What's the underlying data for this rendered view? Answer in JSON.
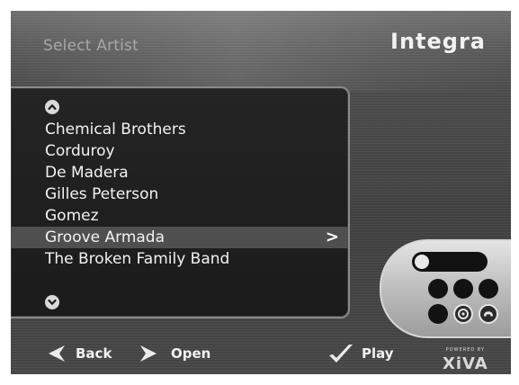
{
  "header": {
    "title": "Select Artist",
    "brand": "Integra"
  },
  "artist_list": {
    "items": [
      "Chemical Brothers",
      "Corduroy",
      "De Madera",
      "Gilles Peterson",
      "Gomez",
      "Groove Armada",
      "The Broken Family Band"
    ],
    "selected_index": 5,
    "selected_indicator": ">"
  },
  "footer": {
    "back_label": "Back",
    "open_label": "Open",
    "play_label": "Play",
    "powered_by": "POWERED BY",
    "logo": "XiVA"
  },
  "icons": {
    "scroll_up": "chevron-up-icon",
    "scroll_down": "chevron-down-icon",
    "back": "arrow-left-icon",
    "open": "arrow-right-icon",
    "play": "checkmark-icon"
  },
  "colors": {
    "background": "#4a4a4a",
    "list_panel": "#1f1f1f",
    "selection": "#4f4f4f",
    "text": "#f2f2f2"
  }
}
